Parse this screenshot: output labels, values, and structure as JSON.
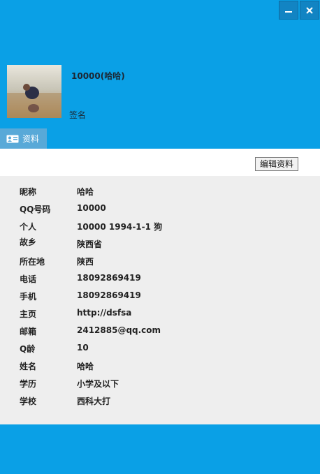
{
  "window": {
    "minimize_glyph": "–",
    "close_glyph": "×"
  },
  "profile": {
    "nickname_line": "10000(哈哈)",
    "signature": "签名"
  },
  "tabs": [
    {
      "label": "资料",
      "icon": "contact-card-icon"
    }
  ],
  "toolbar": {
    "edit_label": "编辑资料"
  },
  "details": [
    {
      "label": "昵称",
      "value": "哈哈"
    },
    {
      "label": "QQ号码",
      "value": "10000"
    },
    {
      "label": "个人",
      "value": "10000  1994-1-1 狗"
    },
    {
      "label": "故乡",
      "value": "陕西省"
    },
    {
      "label": "所在地",
      "value": "陕西"
    },
    {
      "label": "电话",
      "value": "18092869419"
    },
    {
      "label": "手机",
      "value": "18092869419"
    },
    {
      "label": "主页",
      "value": "http://dsfsa"
    },
    {
      "label": "邮箱",
      "value": "2412885@qq.com"
    },
    {
      "label": "Q龄",
      "value": "10"
    },
    {
      "label": "姓名",
      "value": "哈哈"
    },
    {
      "label": "学历",
      "value": "小学及以下"
    },
    {
      "label": "学校",
      "value": "西科大打"
    }
  ],
  "colors": {
    "header_bg": "#0aa0e6",
    "tab_bg": "#58a9d8",
    "panel_bg": "#eeeeee"
  }
}
